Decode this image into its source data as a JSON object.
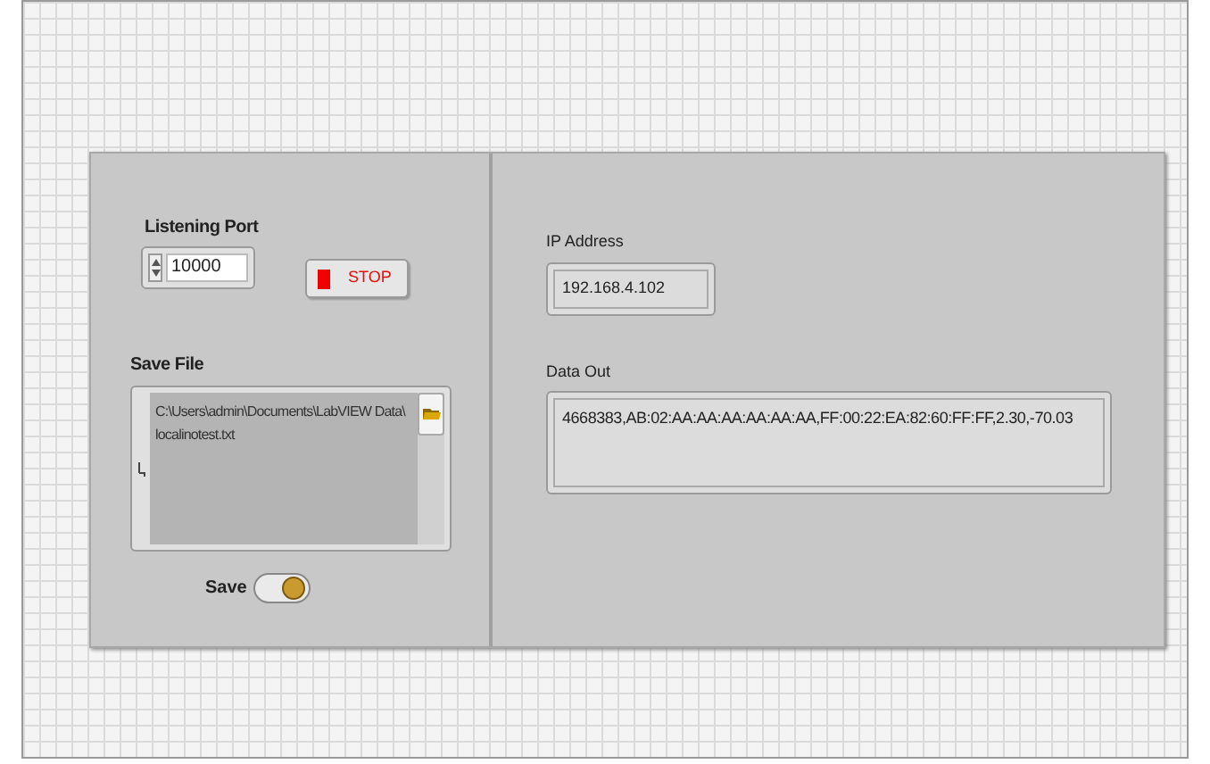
{
  "listening_port": {
    "label": "Listening Port",
    "value": "10000"
  },
  "stop_button": {
    "label": "STOP"
  },
  "save_file": {
    "label": "Save File",
    "value": "C:\\Users\\admin\\Documents\\LabVIEW Data\\ localinotest.txt"
  },
  "save_switch": {
    "label": "Save",
    "on": true
  },
  "ip_address": {
    "label": "IP Address",
    "value": "192.168.4.102"
  },
  "data_out": {
    "label": "Data Out",
    "value": "4668383,AB:02:AA:AA:AA:AA:AA:AA,FF:00:22:EA:82:60:FF:FF,2.30,-70.03"
  }
}
